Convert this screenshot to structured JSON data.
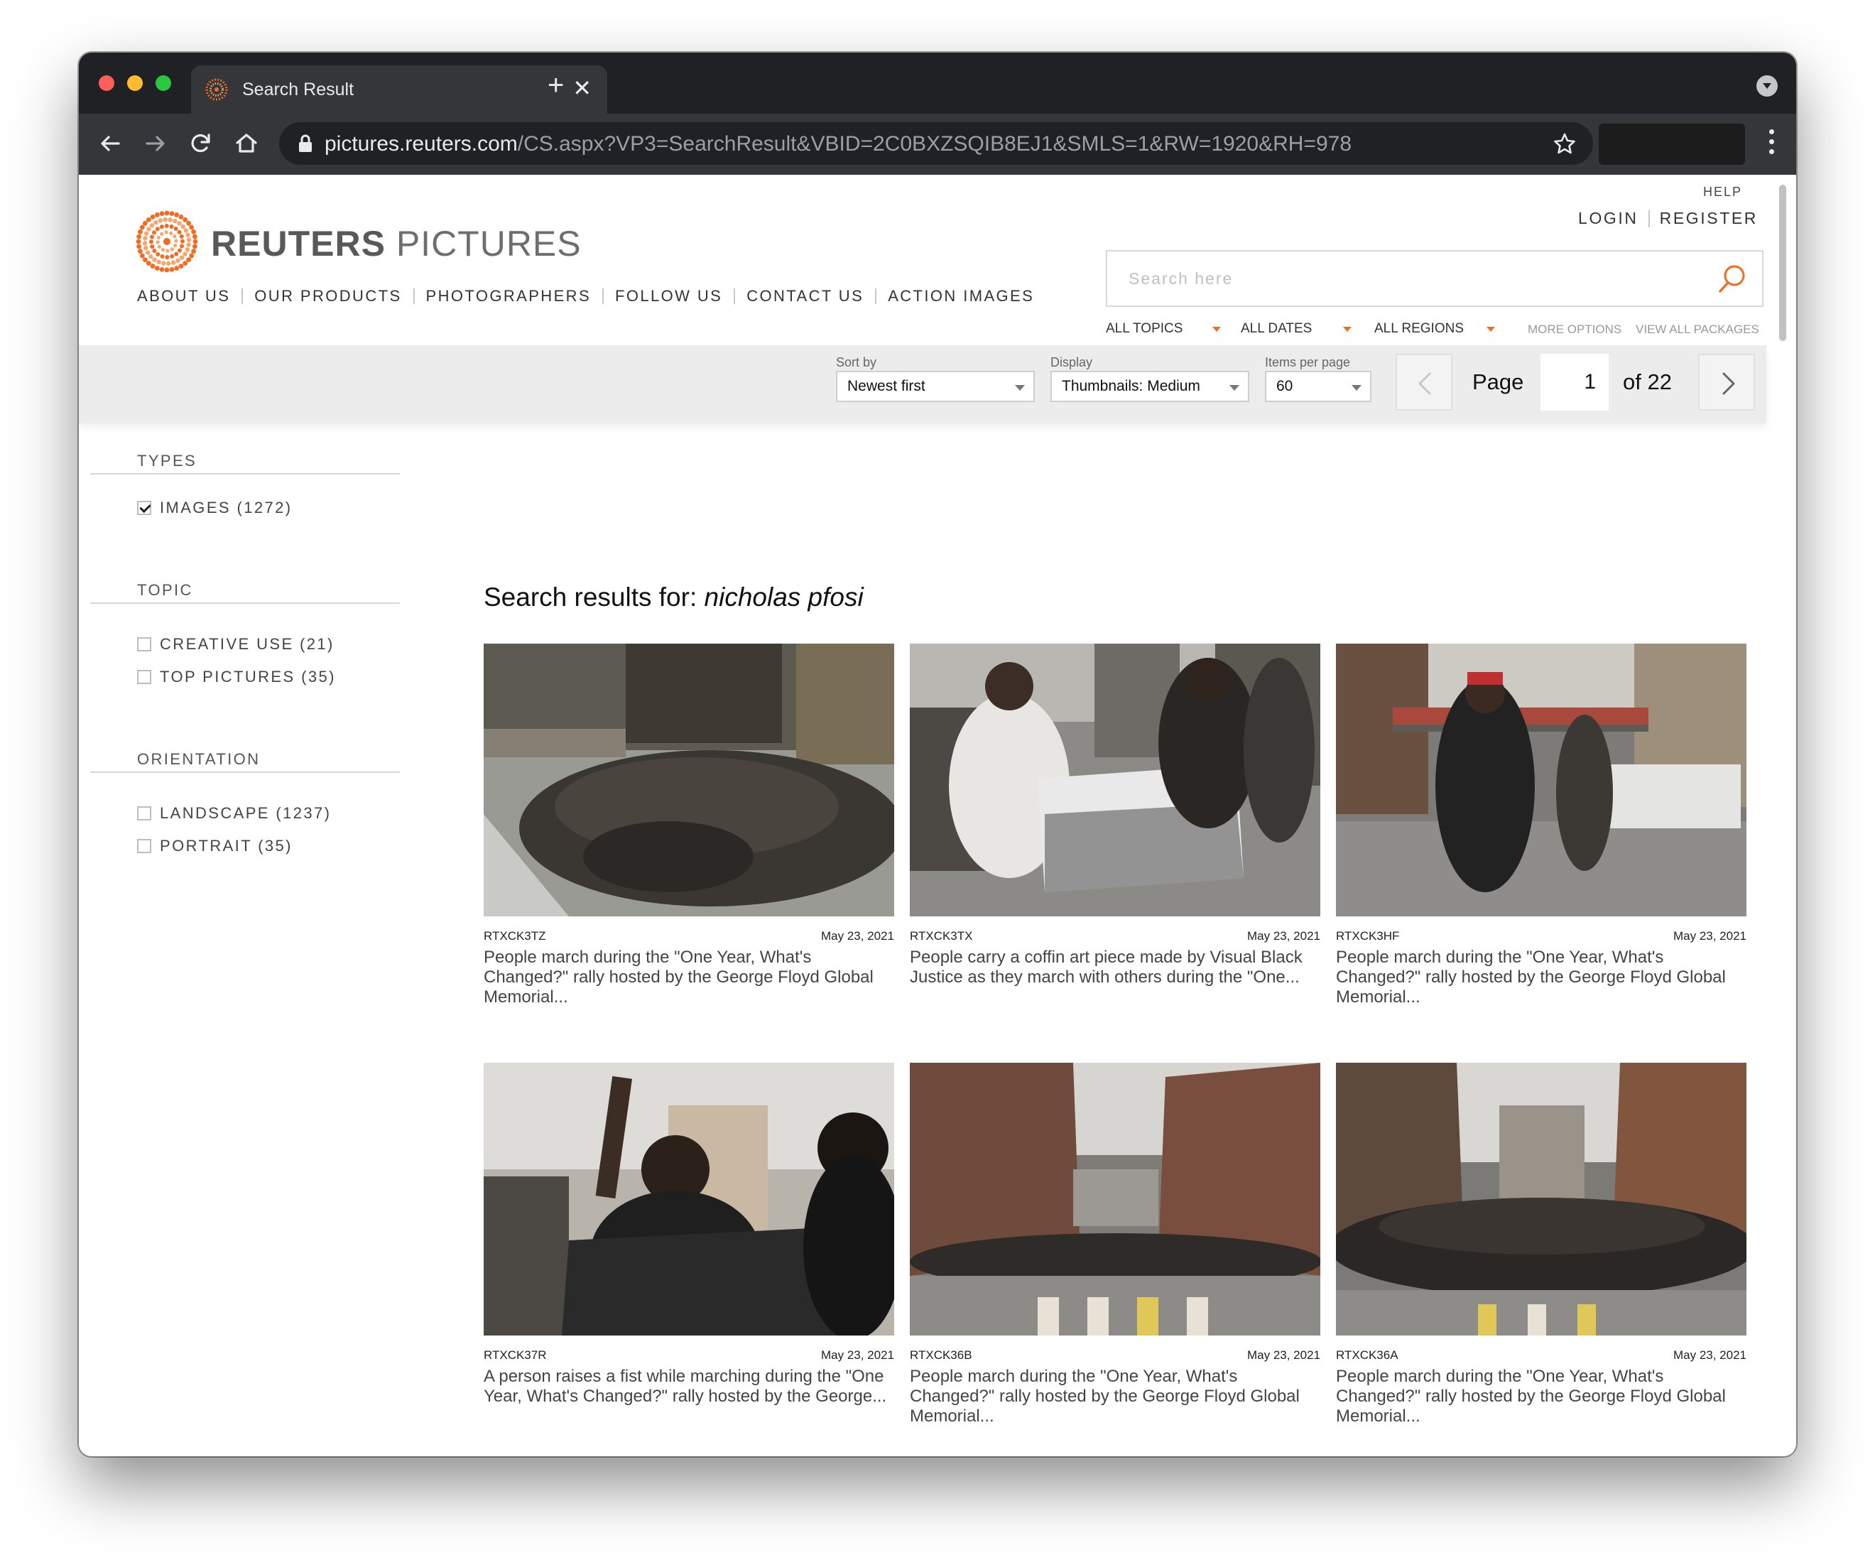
{
  "browser": {
    "tab_title": "Search Result",
    "url_host": "pictures.reuters.com",
    "url_path": "/CS.aspx?VP3=SearchResult&VBID=2C0BXZSQIB8EJ1&SMLS=1&RW=1920&RH=978"
  },
  "brand": {
    "name_bold": "REUTERS",
    "name_light": "PICTURES",
    "accent_color": "#f26b21"
  },
  "nav": {
    "items": [
      "ABOUT US",
      "OUR PRODUCTS",
      "PHOTOGRAPHERS",
      "FOLLOW US",
      "CONTACT US",
      "ACTION IMAGES"
    ]
  },
  "account": {
    "help": "HELP",
    "login": "LOGIN",
    "register": "REGISTER"
  },
  "search": {
    "placeholder": "Search here",
    "value": ""
  },
  "filters": {
    "topics": "ALL TOPICS",
    "dates": "ALL DATES",
    "regions": "ALL REGIONS",
    "more_options": "MORE OPTIONS",
    "view_all_packages": "VIEW ALL PACKAGES"
  },
  "sortbar": {
    "sort_label": "Sort by",
    "sort_value": "Newest first",
    "display_label": "Display",
    "display_value": "Thumbnails: Medium",
    "per_page_label": "Items per page",
    "per_page_value": "60",
    "page_label": "Page",
    "page_value": "1",
    "page_total": "of 22"
  },
  "sidebar": {
    "types_title": "TYPES",
    "types": [
      {
        "label": "IMAGES (1272)",
        "checked": true
      }
    ],
    "topic_title": "TOPIC",
    "topics": [
      {
        "label": "CREATIVE USE (21)",
        "checked": false
      },
      {
        "label": "TOP PICTURES (35)",
        "checked": false
      }
    ],
    "orientation_title": "ORIENTATION",
    "orientation": [
      {
        "label": "LANDSCAPE (1237)",
        "checked": false
      },
      {
        "label": "PORTRAIT (35)",
        "checked": false
      }
    ]
  },
  "results": {
    "heading": "Search results for: ",
    "query": "nicholas pfosi",
    "items": [
      {
        "id": "RTXCK3TZ",
        "date": "May 23, 2021",
        "caption": "People march during the \"One Year, What's Changed?\" rally hosted by the George Floyd Global Memorial..."
      },
      {
        "id": "RTXCK3TX",
        "date": "May 23, 2021",
        "caption": "People carry a coffin art piece made by Visual Black Justice as they march with others during the \"One..."
      },
      {
        "id": "RTXCK3HF",
        "date": "May 23, 2021",
        "caption": "People march during the \"One Year, What's Changed?\" rally hosted by the George Floyd Global Memorial..."
      },
      {
        "id": "RTXCK37R",
        "date": "May 23, 2021",
        "caption": "A person raises a fist while marching during the \"One Year, What's Changed?\" rally hosted by the George..."
      },
      {
        "id": "RTXCK36B",
        "date": "May 23, 2021",
        "caption": "People march during the \"One Year, What's Changed?\" rally hosted by the George Floyd Global Memorial..."
      },
      {
        "id": "RTXCK36A",
        "date": "May 23, 2021",
        "caption": "People march during the \"One Year, What's Changed?\" rally hosted by the George Floyd Global Memorial..."
      }
    ]
  }
}
